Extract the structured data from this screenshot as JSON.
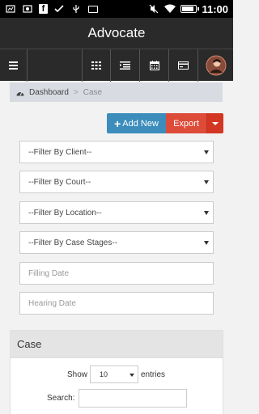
{
  "status_bar": {
    "time": "11:00",
    "battery_level": 0.9,
    "left_icons": [
      "media-icon",
      "photo-icon",
      "facebook-icon",
      "check-icon",
      "usb-icon",
      "mail-icon"
    ],
    "right_icons": [
      "mute-icon",
      "wifi-icon",
      "battery-icon"
    ]
  },
  "app": {
    "title": "Advocate"
  },
  "toolbar": {
    "icons": [
      "menu-icon",
      "grid-icon",
      "list-icon",
      "calendar-icon",
      "card-icon",
      "avatar"
    ]
  },
  "breadcrumb": {
    "home_label": "Dashboard",
    "separator": ">",
    "current": "Case"
  },
  "actions": {
    "add_label": "Add New",
    "add_icon": "+",
    "export_label": "Export"
  },
  "filters": {
    "client": "--Filter By Client--",
    "court": "--Filter By Court--",
    "location": "--Filter By Location--",
    "stage": "--Filter By Case Stages--",
    "filling_date_placeholder": "Filling Date",
    "hearing_date_placeholder": "Hearing Date"
  },
  "case_panel": {
    "title": "Case",
    "show_label": "Show",
    "entries_value": "10",
    "entries_label": "entries",
    "search_label": "Search:"
  },
  "colors": {
    "primary": "#3c8dbc",
    "danger": "#dd4b39",
    "header": "#2a2a2a"
  }
}
